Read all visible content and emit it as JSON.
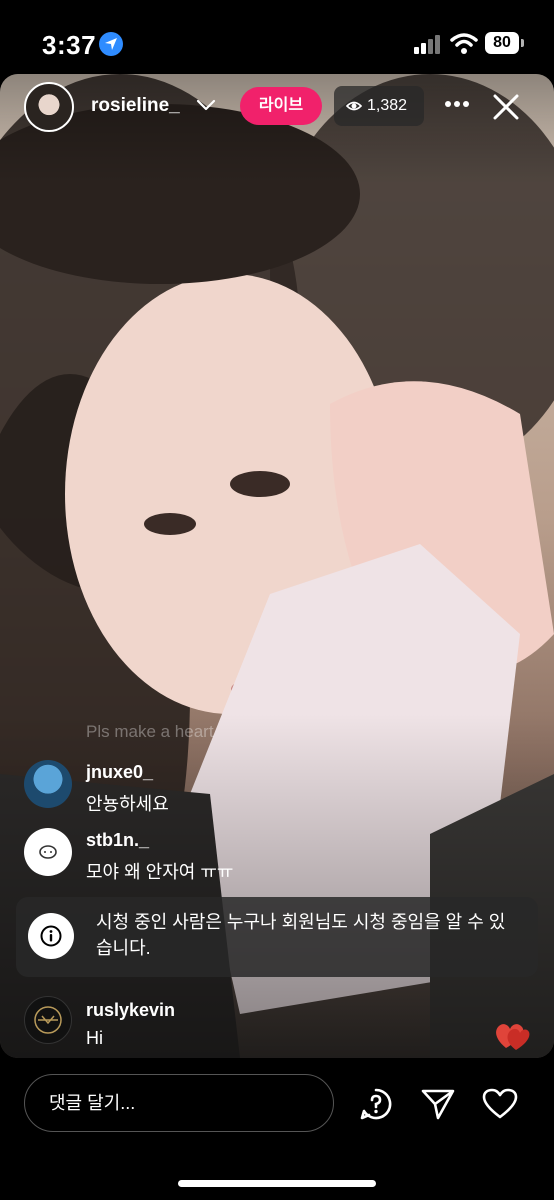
{
  "status_bar": {
    "time": "3:37",
    "battery": "80"
  },
  "header": {
    "username": "rosieline_",
    "live_label": "라이브",
    "viewer_count": "1,382"
  },
  "comments_faded": "Pls make a heart",
  "comments": [
    {
      "user": "jnuxe0_",
      "text": "안뇽하세요"
    },
    {
      "user": "stb1n._",
      "text": "모야 왜 안자여 ㅠㅠ"
    }
  ],
  "notice": {
    "text": "시청 중인 사람은 누구나 회원님도 시청 중임을 알 수 있습니다."
  },
  "last_comment": {
    "user": "ruslykevin",
    "text": "Hi"
  },
  "composer": {
    "placeholder": "댓글 달기..."
  },
  "colors": {
    "live_badge": "#f1216b",
    "location_icon": "#2f8cff"
  },
  "icons": [
    "location-icon",
    "signal-icon",
    "wifi-icon",
    "battery-icon",
    "chevron-down-icon",
    "eye-icon",
    "more-icon",
    "close-icon",
    "info-icon",
    "heart-reaction-icon",
    "question-icon",
    "send-icon",
    "heart-icon"
  ]
}
